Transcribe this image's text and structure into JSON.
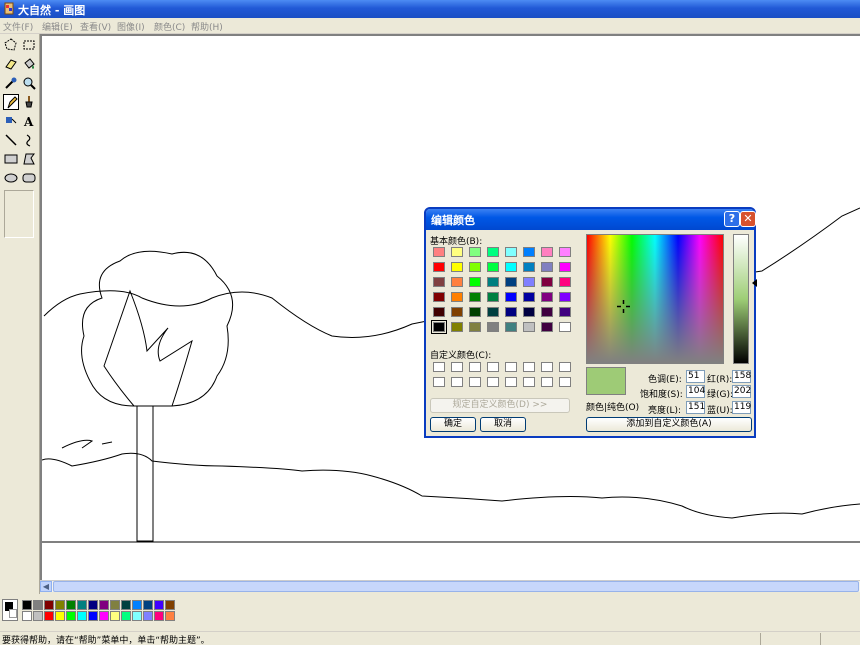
{
  "window": {
    "title": "大自然 - 画图"
  },
  "menu": [
    {
      "label": "文件(F)"
    },
    {
      "label": "编辑(E)"
    },
    {
      "label": "查看(V)"
    },
    {
      "label": "图像(I)"
    },
    {
      "label": "颜色(C)"
    },
    {
      "label": "帮助(H)"
    }
  ],
  "tools": [
    {
      "name": "free-select-icon"
    },
    {
      "name": "rect-select-icon"
    },
    {
      "name": "eraser-icon"
    },
    {
      "name": "fill-icon"
    },
    {
      "name": "color-picker-icon"
    },
    {
      "name": "magnifier-icon"
    },
    {
      "name": "pencil-icon",
      "selected": true
    },
    {
      "name": "brush-icon"
    },
    {
      "name": "airbrush-icon"
    },
    {
      "name": "text-icon",
      "glyph": "A"
    },
    {
      "name": "line-icon"
    },
    {
      "name": "curve-icon"
    },
    {
      "name": "rectangle-icon"
    },
    {
      "name": "polygon-icon"
    },
    {
      "name": "ellipse-icon"
    },
    {
      "name": "rounded-rect-icon"
    }
  ],
  "palette": {
    "top": [
      "#000000",
      "#808080",
      "#800000",
      "#808000",
      "#008000",
      "#008080",
      "#000080",
      "#800080",
      "#808040",
      "#004040",
      "#0080ff",
      "#004080",
      "#4000ff",
      "#804000"
    ],
    "bottom": [
      "#ffffff",
      "#c0c0c0",
      "#ff0000",
      "#ffff00",
      "#00ff00",
      "#00ffff",
      "#0000ff",
      "#ff00ff",
      "#ffff80",
      "#00ff80",
      "#80ffff",
      "#8080ff",
      "#ff0080",
      "#ff8040"
    ]
  },
  "status": {
    "text": "要获得帮助，请在“帮助”菜单中，单击“帮助主题”。"
  },
  "dialog": {
    "title": "编辑颜色",
    "help_button": "?",
    "close_button": "✕",
    "basic_colors_label": "基本颜色(B):",
    "basic_colors": [
      "#ff8080",
      "#ffff80",
      "#80ff80",
      "#00ff80",
      "#80ffff",
      "#0080ff",
      "#ff80c0",
      "#ff80ff",
      "#ff0000",
      "#ffff00",
      "#80ff00",
      "#00ff40",
      "#00ffff",
      "#0080c0",
      "#8080c0",
      "#ff00ff",
      "#804040",
      "#ff8040",
      "#00ff00",
      "#008080",
      "#004080",
      "#8080ff",
      "#800040",
      "#ff0080",
      "#800000",
      "#ff8000",
      "#008000",
      "#008040",
      "#0000ff",
      "#0000a0",
      "#800080",
      "#8000ff",
      "#400000",
      "#804000",
      "#004000",
      "#004040",
      "#000080",
      "#000040",
      "#400040",
      "#400080",
      "#000000",
      "#808000",
      "#808040",
      "#808080",
      "#408080",
      "#c0c0c0",
      "#400040",
      "#ffffff"
    ],
    "selected_basic_index": 40,
    "custom_colors_label": "自定义颜色(C):",
    "define_custom_label": "规定自定义颜色(D) >>",
    "ok_label": "确定",
    "cancel_label": "取消",
    "preview_label": "颜色|纯色(O)",
    "hue_label": "色调(E):",
    "hue": "51",
    "sat_label": "饱和度(S):",
    "sat": "104",
    "lum_label": "亮度(L):",
    "lum": "151",
    "red_label": "红(R):",
    "red": "158",
    "green_label": "绿(G):",
    "green": "202",
    "blue_label": "蓝(U):",
    "blue": "119",
    "add_custom_label": "添加到自定义颜色(A)",
    "current_color": "#9ecb76"
  }
}
